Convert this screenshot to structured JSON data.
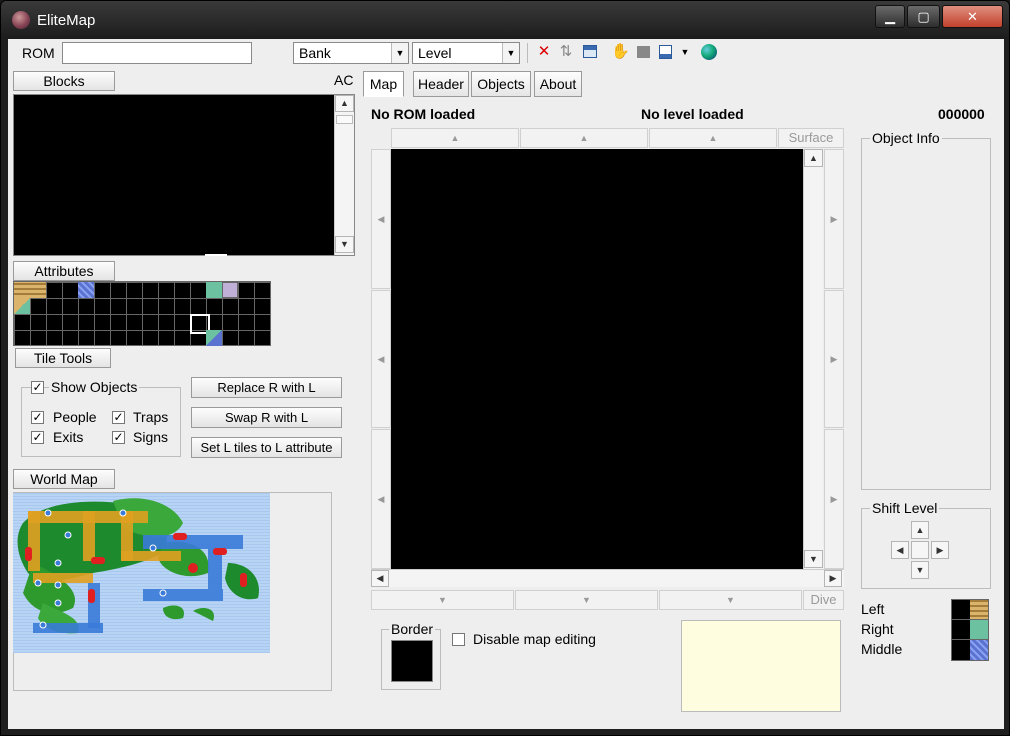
{
  "window": {
    "title": "EliteMap",
    "min_glyph": "▁",
    "max_glyph": "▢",
    "close_glyph": "✕"
  },
  "toolbar": {
    "rom_label": "ROM",
    "rom_value": "",
    "bank_select": {
      "selected": "Bank"
    },
    "level_select": {
      "selected": "Level"
    },
    "icons": [
      "close-rom-icon",
      "sort-icon",
      "table-icon",
      "hand-icon",
      "chip-icon",
      "save-icon",
      "dropdown-icon",
      "globe-icon"
    ]
  },
  "left": {
    "blocks_button": "Blocks",
    "ac_label": "AC",
    "attributes_button": "Attributes",
    "tile_tools_button": "Tile Tools",
    "show_objects": {
      "label": "Show Objects",
      "checked": true
    },
    "people": {
      "label": "People",
      "checked": true
    },
    "traps": {
      "label": "Traps",
      "checked": true
    },
    "exits": {
      "label": "Exits",
      "checked": true
    },
    "signs": {
      "label": "Signs",
      "checked": true
    },
    "replace_button": "Replace R with L",
    "swap_button": "Swap R with L",
    "set_attr_button": "Set L tiles to L attribute",
    "world_map_button": "World Map"
  },
  "tabs": [
    {
      "label": "Map",
      "active": true
    },
    {
      "label": "Header",
      "active": false
    },
    {
      "label": "Objects",
      "active": false
    },
    {
      "label": "About",
      "active": false
    }
  ],
  "status": {
    "rom": "No ROM loaded",
    "level": "No level loaded",
    "offset": "000000"
  },
  "map": {
    "surface_label": "Surface",
    "dive_label": "Dive"
  },
  "bottom": {
    "border_label": "Border",
    "disable_editing": {
      "label": "Disable map editing",
      "checked": false
    }
  },
  "right": {
    "object_info_label": "Object Info",
    "shift_level_label": "Shift Level",
    "tiles": [
      {
        "label": "Left",
        "color": "#d9b46a"
      },
      {
        "label": "Right",
        "color": "#6cc1a0"
      },
      {
        "label": "Middle",
        "color": "#5a72d0"
      }
    ]
  },
  "colors": {
    "panel": "#000000",
    "note_bg": "#fffde0",
    "worldmap_water": "#a8c8f0"
  }
}
